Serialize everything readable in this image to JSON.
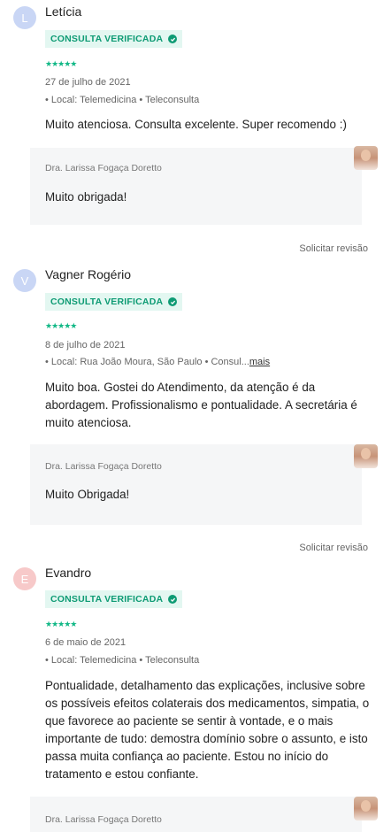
{
  "reviews": [
    {
      "initial": "L",
      "avatar_color": "#c9d6f5",
      "name": "Letícia",
      "badge": "CONSULTA VERIFICADA",
      "stars": "★★★★★",
      "date": "27 de julho de 2021",
      "location": "• Local: Telemedicina • Teleconsulta",
      "more": "",
      "text": "Muito atenciosa. Consulta excelente. Super recomendo :)",
      "reply_doctor": "Dra. Larissa Fogaça Doretto",
      "reply_text": "Muito obrigada!",
      "solicit": "Solicitar revisão"
    },
    {
      "initial": "V",
      "avatar_color": "#c9d6f5",
      "name": "Vagner Rogério",
      "badge": "CONSULTA VERIFICADA",
      "stars": "★★★★★",
      "date": "8 de julho de 2021",
      "location": "• Local: Rua João Moura, São Paulo • Consul...",
      "more": "mais",
      "text": "Muito boa. Gostei do Atendimento, da atenção é da abordagem. Profissionalismo e pontualidade. A secretária é muito atenciosa.",
      "reply_doctor": "Dra. Larissa Fogaça Doretto",
      "reply_text": "Muito Obrigada!",
      "solicit": "Solicitar revisão"
    },
    {
      "initial": "E",
      "avatar_color": "#f7c9c9",
      "name": "Evandro",
      "badge": "CONSULTA VERIFICADA",
      "stars": "★★★★★",
      "date": "6 de maio de 2021",
      "location": "• Local: Telemedicina • Teleconsulta",
      "more": "",
      "text": "Pontualidade, detalhamento das explicações, inclusive sobre os possíveis efeitos colaterais dos medicamentos, simpatia, o que favorece ao paciente se sentir à vontade, e o mais importante de tudo: demostra domínio sobre o assunto, e isto passa muita confiança ao paciente. Estou no início do tratamento e estou confiante.",
      "reply_doctor": "Dra. Larissa Fogaça Doretto"
    }
  ]
}
